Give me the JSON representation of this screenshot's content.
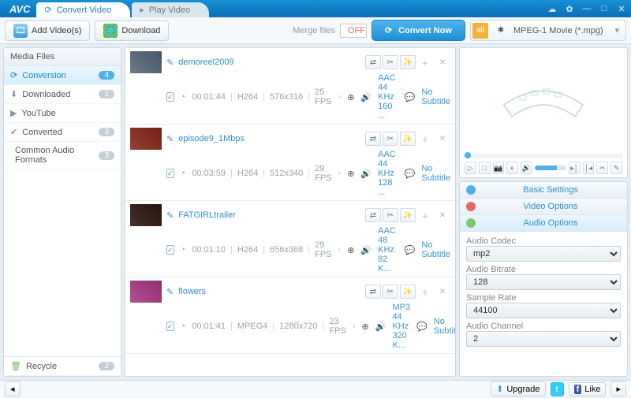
{
  "app": {
    "logo": "AVC"
  },
  "tabs": [
    {
      "label": "Convert Video",
      "active": true
    },
    {
      "label": "Play Video",
      "active": false
    }
  ],
  "toolbar": {
    "add_videos": "Add Video(s)",
    "download": "Download",
    "merge_label": "Merge files",
    "merge_state": "OFF",
    "convert_now": "Convert Now",
    "profile_label": "MPEG-1 Movie (*.mpg)"
  },
  "sidebar": {
    "head": "Media Files",
    "items": [
      {
        "icon": "conversion",
        "label": "Conversion",
        "count": "4",
        "active": true
      },
      {
        "icon": "downloaded",
        "label": "Downloaded",
        "count": "1"
      },
      {
        "icon": "youtube",
        "label": "YouTube",
        "count": ""
      },
      {
        "icon": "converted",
        "label": "Converted",
        "count": "3"
      },
      {
        "icon": "audio",
        "label": "Common Audio Formats",
        "count": "3"
      }
    ],
    "recycle": {
      "label": "Recycle",
      "count": "2"
    }
  },
  "files": [
    {
      "title": "demoreel2009",
      "duration": "00:01:44",
      "codec": "H264",
      "res": "576x316",
      "fps": "25 FPS",
      "audio": "AAC 44 KHz 160 ...",
      "subtitle": "No Subtitle",
      "thumb": "#5a6c7d"
    },
    {
      "title": "episode9_1Mbps",
      "duration": "00:03:59",
      "codec": "H264",
      "res": "512x340",
      "fps": "29 FPS",
      "audio": "AAC 44 KHz 128 ...",
      "subtitle": "No Subtitle",
      "thumb": "#8a2a1a"
    },
    {
      "title": "FATGIRLtrailer",
      "duration": "00:01:10",
      "codec": "H264",
      "res": "656x368",
      "fps": "29 FPS",
      "audio": "AAC 48 KHz 82 K...",
      "subtitle": "No Subtitle",
      "thumb": "#2d1a12"
    },
    {
      "title": "flowers",
      "duration": "00:01:41",
      "codec": "MPEG4",
      "res": "1280x720",
      "fps": "23 FPS",
      "audio": "MP3 44 KHz 320 K...",
      "subtitle": "No Subtitle",
      "thumb": "#b03a8a"
    }
  ],
  "accordion": {
    "basic": "Basic Settings",
    "video": "Video Options",
    "audio": "Audio Options",
    "fields": {
      "codec_label": "Audio Codec",
      "codec_value": "mp2",
      "bitrate_label": "Audio Bitrate",
      "bitrate_value": "128",
      "sample_label": "Sample Rate",
      "sample_value": "44100",
      "channel_label": "Audio Channel",
      "channel_value": "2"
    }
  },
  "status": {
    "upgrade": "Upgrade",
    "like": "Like"
  }
}
